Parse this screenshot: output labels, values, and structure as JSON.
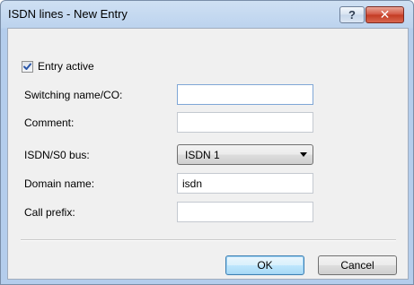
{
  "window": {
    "title": "ISDN lines - New Entry",
    "help_glyph": "?",
    "close_glyph": "✕"
  },
  "form": {
    "entry_active": {
      "label": "Entry active",
      "checked": true
    },
    "switching_name": {
      "label": "Switching name/CO:",
      "value": ""
    },
    "comment": {
      "label": "Comment:",
      "value": ""
    },
    "isdn_bus": {
      "label": "ISDN/S0 bus:",
      "selected": "ISDN 1"
    },
    "domain_name": {
      "label": "Domain name:",
      "value": "isdn"
    },
    "call_prefix": {
      "label": "Call prefix:",
      "value": ""
    }
  },
  "buttons": {
    "ok": "OK",
    "cancel": "Cancel"
  },
  "icons": {
    "help": "help-icon",
    "close": "close-icon",
    "checkmark": "checkmark-icon",
    "dropdown": "chevron-down-icon"
  },
  "colors": {
    "titlebar": "#bcd3ee",
    "client_bg": "#f0f0f0",
    "close_button": "#c23a22",
    "check_color": "#2a56a8"
  }
}
